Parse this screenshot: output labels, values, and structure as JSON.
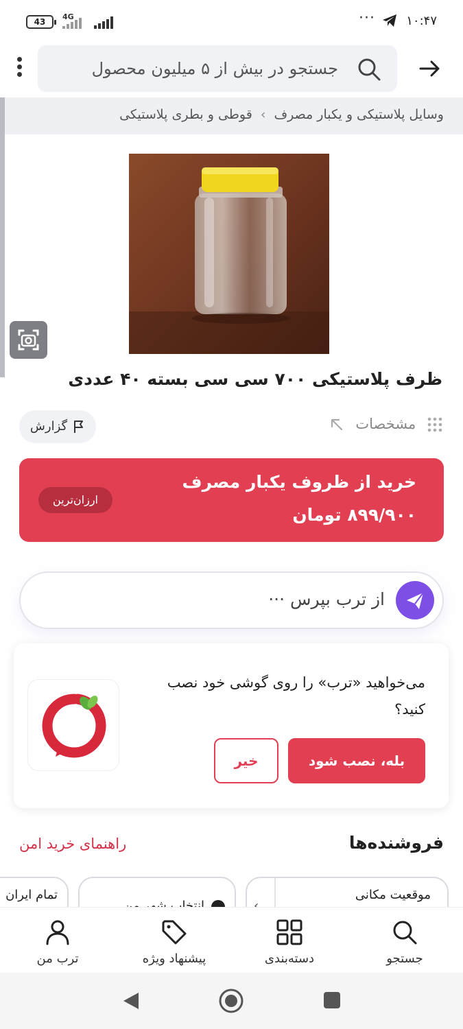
{
  "status_bar": {
    "battery": "43",
    "network": "4G",
    "time": "۱۰:۴۷",
    "overflow": "···"
  },
  "header": {
    "search_placeholder": "جستجو در بیش از ۵ میلیون محصول"
  },
  "breadcrumb": {
    "items": [
      "وسایل پلاستیکی و یکبار مصرف",
      "قوطی و بطری پلاستیکی"
    ],
    "separator": "›"
  },
  "product": {
    "title": "ظرف پلاستیکی ۷۰۰ سی سی بسته ۴۰ عددی",
    "specs_label": "مشخصات",
    "report_label": "گزارش"
  },
  "offer": {
    "title": "خرید از ظروف یکبار مصرف",
    "price": "۸۹۹/۹۰۰ تومان",
    "badge": "ارزان‌ترین"
  },
  "ask": {
    "placeholder": "از ترب بپرس ···"
  },
  "install_prompt": {
    "text": "می‌خواهید «ترب» را روی گوشی خود نصب کنید؟",
    "yes_label": "بله، نصب شود",
    "no_label": "خیر"
  },
  "sellers": {
    "heading": "فروشنده‌ها",
    "safe_guide": "راهنمای خرید امن",
    "filters": {
      "location": "موقعیت مکانی",
      "city": "انتخاب شهر من",
      "all_iran": "تمام ایران"
    }
  },
  "bottom_nav": {
    "items": [
      {
        "label": "جستجو",
        "icon": "search-icon"
      },
      {
        "label": "دسته‌بندی",
        "icon": "grid-icon"
      },
      {
        "label": "پیشنهاد ویژه",
        "icon": "tag-icon"
      },
      {
        "label": "ترب من",
        "icon": "user-icon"
      }
    ]
  },
  "colors": {
    "brand_red": "#e23f52",
    "ask_purple": "#7e4fe6",
    "link_red": "#d23349"
  }
}
